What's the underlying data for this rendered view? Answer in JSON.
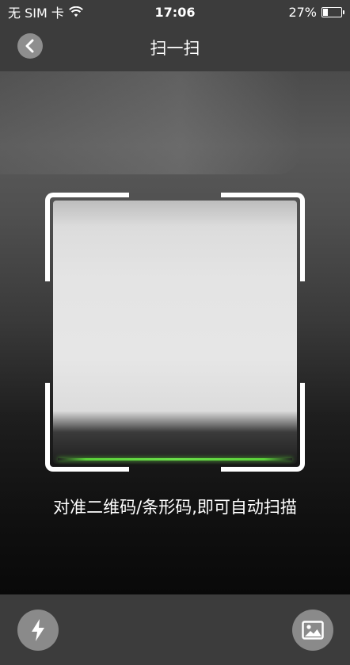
{
  "status_bar": {
    "carrier": "无 SIM 卡",
    "time": "17:06",
    "battery_percent": "27%",
    "battery_level": 0.27,
    "wifi_icon": "wifi-icon",
    "battery_icon": "battery-icon"
  },
  "nav": {
    "title": "扫一扫",
    "back_icon": "chevron-left-icon"
  },
  "scanner": {
    "hint": "对准二维码/条形码,即可自动扫描",
    "scan_line_color": "#5bd23a"
  },
  "toolbar": {
    "flash_icon": "flash-icon",
    "album_icon": "image-icon"
  }
}
